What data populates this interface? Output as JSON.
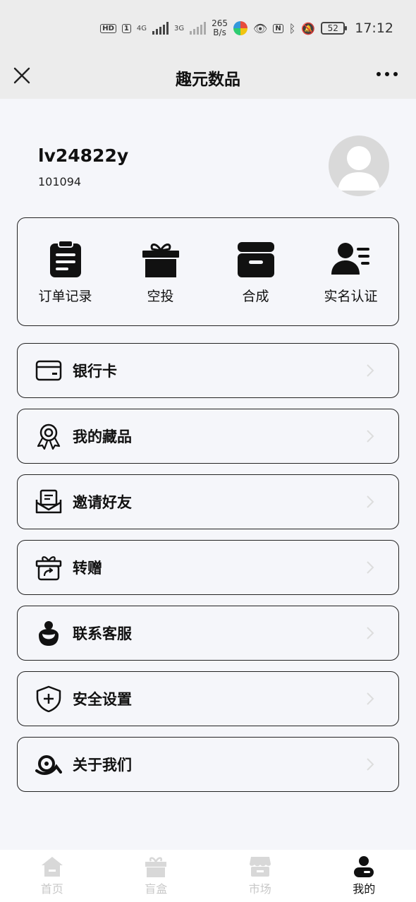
{
  "status_bar": {
    "hd_badge": "HD",
    "sim1": "1",
    "net1": "4G",
    "net2": "3G",
    "speed_value": "265",
    "speed_unit": "B/s",
    "nfc": "N",
    "battery": "52",
    "time": "17:12"
  },
  "nav": {
    "title": "趣元数品"
  },
  "profile": {
    "username": "lv24822y",
    "user_id": "101094"
  },
  "quick_actions": [
    {
      "label": "订单记录",
      "icon": "clipboard-icon"
    },
    {
      "label": "空投",
      "icon": "gift-icon"
    },
    {
      "label": "合成",
      "icon": "archive-box-icon"
    },
    {
      "label": "实名认证",
      "icon": "id-card-icon"
    }
  ],
  "menu": [
    {
      "label": "银行卡",
      "icon": "bank-card-icon"
    },
    {
      "label": "我的藏品",
      "icon": "award-ribbon-icon"
    },
    {
      "label": "邀请好友",
      "icon": "envelope-icon"
    },
    {
      "label": "转赠",
      "icon": "gift-share-icon"
    },
    {
      "label": "联系客服",
      "icon": "customer-service-icon"
    },
    {
      "label": "安全设置",
      "icon": "shield-plus-icon"
    },
    {
      "label": "关于我们",
      "icon": "about-logo-icon"
    }
  ],
  "tabs": [
    {
      "label": "首页",
      "icon": "home-icon",
      "active": false
    },
    {
      "label": "盲盒",
      "icon": "blind-box-icon",
      "active": false
    },
    {
      "label": "市场",
      "icon": "market-icon",
      "active": false
    },
    {
      "label": "我的",
      "icon": "profile-icon",
      "active": true
    }
  ],
  "colors": {
    "page_bg": "#f5f6fa",
    "header_bg": "#ececec",
    "text": "#111111",
    "tab_inactive": "#c8c8c8",
    "avatar_bg": "#d9d9d9"
  }
}
